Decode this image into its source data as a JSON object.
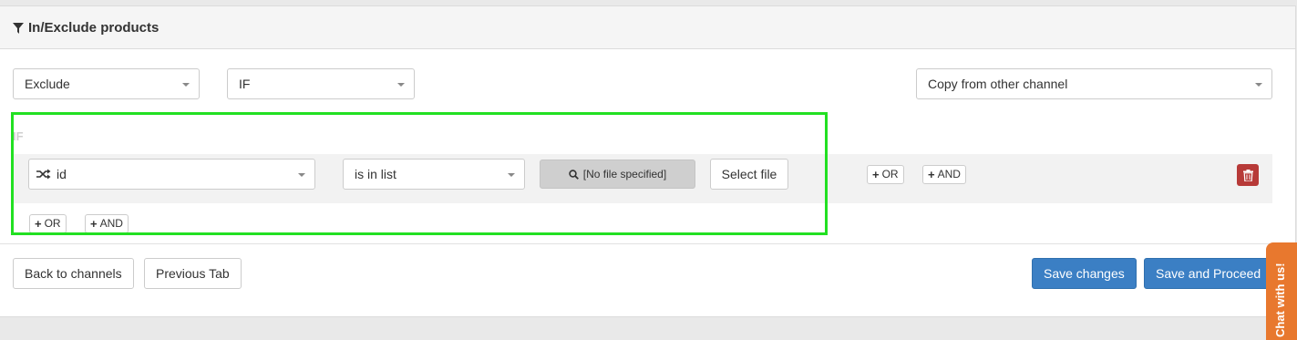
{
  "panel": {
    "title": "In/Exclude products"
  },
  "filters": {
    "mode_select": "Exclude",
    "condition_select": "IF",
    "copy_select": "Copy from other channel"
  },
  "rule_group": {
    "label": "IF",
    "field_select": "id",
    "operator_select": "is in list",
    "file_status": "[No file specified]",
    "select_file_label": "Select file",
    "or_label": "OR",
    "and_label": "AND"
  },
  "group_actions": {
    "or_label": "OR",
    "and_label": "AND"
  },
  "footer": {
    "back_label": "Back to channels",
    "previous_label": "Previous Tab",
    "save_label": "Save changes",
    "save_proceed_label": "Save and Proceed"
  },
  "chat": {
    "label": "Chat with us!"
  },
  "colors": {
    "primary": "#3b7fc4",
    "danger": "#b73a38",
    "highlight": "#22e022",
    "chat": "#e8782e"
  }
}
